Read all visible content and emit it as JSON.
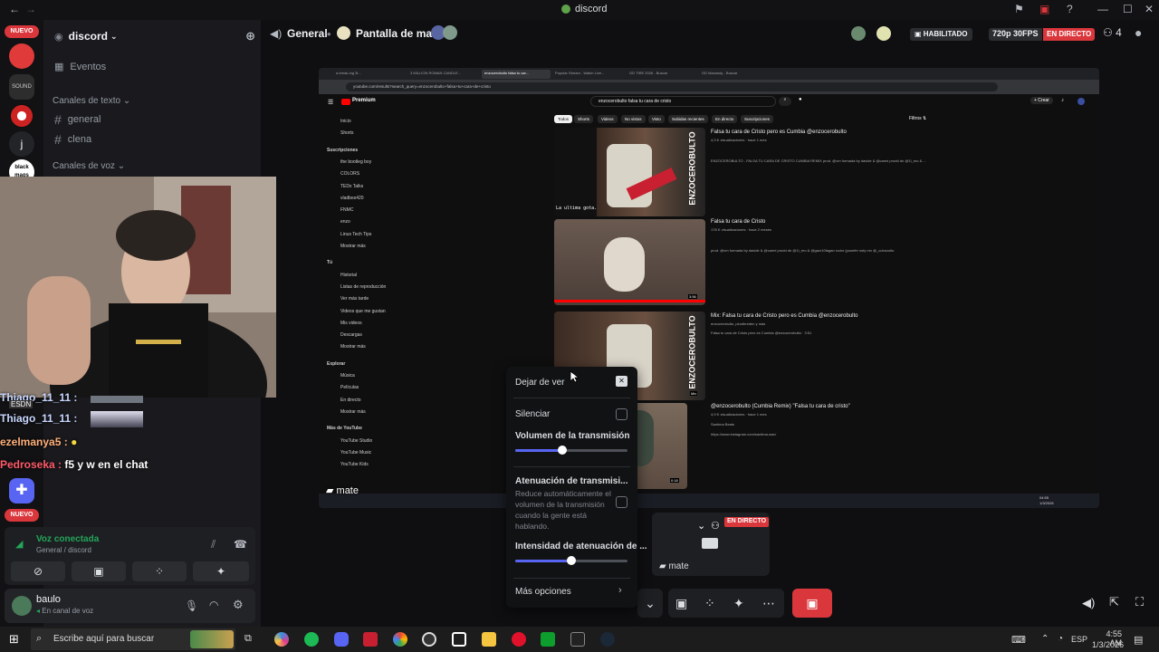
{
  "window": {
    "title": "discord"
  },
  "server_rail": {
    "nuevo_label": "NUEVO",
    "server_letter": "j",
    "server_text_a": "SOUND",
    "server_text_b": "black mags"
  },
  "channels": {
    "server_name": "discord",
    "events": "Eventos",
    "text_category": "Canales de texto",
    "text_channels": [
      "general",
      "clena"
    ],
    "voice_category": "Canales de voz"
  },
  "chat_overlay": {
    "lines": [
      {
        "user": "Thiago_11_11 :",
        "text": ""
      },
      {
        "user": "Thiago_11_11 :",
        "text": ""
      },
      {
        "user": "ezelmanya5 :",
        "text": ""
      },
      {
        "user": "Pedroseka :",
        "text": "f5 y w en el chat"
      }
    ],
    "small_tag": "ESDN"
  },
  "voice": {
    "status": "Voz conectada",
    "location": "General / discord"
  },
  "user": {
    "name": "baulo",
    "status": "En canal de voz"
  },
  "header": {
    "channel": "General",
    "stream_name": "Pantalla de mate",
    "enabled_badge": "HABILITADO",
    "quality": "720p 30FPS",
    "live_badge": "EN DIRECTO",
    "viewers": "4"
  },
  "stream": {
    "streamer_label": "mate",
    "browser": {
      "address": "youtube.com/results?search_query=enzocerobulto+falsa+tu+cara+de+cristo",
      "tabs": [
        "a break-ing 3t...",
        "3 MILLION ROMAN CANDLE...",
        "enzocerobulto falsa tu car...",
        "Popular Stream - Watch Live...",
        "GD TIRE 2026 - Buscar",
        "GD Maxandy - Buscar"
      ]
    },
    "youtube": {
      "logo": "Premium",
      "search": "enzocerobulto falsa tu cara de cristo",
      "create": "+ Crear",
      "filters": "Filtros",
      "chips": [
        "Todos",
        "Shorts",
        "Videos",
        "No vistos",
        "Visto",
        "Subidas recientes",
        "En directo",
        "Suscripciones"
      ],
      "sidebar": [
        "Inicio",
        "Shorts",
        "Suscripciones",
        "the bootleg boy",
        "COLORS",
        "TEDx Talks",
        "vladbes420",
        "FNMC",
        "enzo",
        "Linus Tech Tips",
        "Mostrar más",
        "Tú",
        "Historial",
        "Listas de reproducción",
        "Ver más tarde",
        "Videos que me gustan",
        "Mis videos",
        "Descargas",
        "Mostrar más",
        "Explorar",
        "Música",
        "Películas",
        "En directo",
        "Mostrar más",
        "Más de YouTube",
        "YouTube Studio",
        "YouTube Music",
        "YouTube Kids"
      ],
      "thumb_text": "ENZOCEROBULTO",
      "thumb_caption": "La ultima gota.",
      "thumb2_duration": "3:56",
      "thumb4_duration": "0:18",
      "videos": [
        {
          "title": "Falsa tu cara de Cristo pero es Cumbia @enzocerobulto",
          "meta": "4,3 K visualizaciones · hace 1 mes",
          "desc": "ENZOCEROBULTO - FALSA TU CARA DE CRISTO CUMBIA REMIX prod. @vm formada by davide & @carmi prodd dn @1l_ero & ..."
        },
        {
          "title": "Falsa tu cara de Cristo",
          "meta": "178 K visualizaciones · hace 2 meses",
          "desc": "prod. @vm formada by davide & @carmi prodd dn @1l_ero & @gacr10fagan rudor (pusefer ssfy mn @_cuboculto"
        },
        {
          "title": "Mix: Falsa tu cara de Cristo pero es Cumbia @enzocerobulto",
          "meta": "enzocerobulto, pinothreden y más",
          "desc": "Falsa tu cara de Cristo pero es Cumbia @enzocerobulto · 3:51"
        },
        {
          "title": "@enzocerobulto (Cumbia Remix) \"Falsa tu cara de cristo\"",
          "meta": "4,9 K visualizaciones · hace 1 mes",
          "desc": "https://www.instagram.com/santima.wav/"
        }
      ],
      "mix_badge": "Mix",
      "channel_4": "Santima Beats",
      "taskbar_time": "04:55",
      "taskbar_date": "1/3/2026"
    }
  },
  "popup": {
    "stop_watching": "Dejar de ver",
    "mute": "Silenciar",
    "volume_label": "Volumen de la transmisión",
    "volume": 0.42,
    "attenuation_label": "Atenuación de transmisi...",
    "attenuation_desc": "Reduce automáticamente el volumen de la transmisión cuando la gente está hablando.",
    "intensity_label": "Intensidad de atenuación de ...",
    "intensity": 0.5,
    "more_options": "Más opciones"
  },
  "mini_tile": {
    "live": "EN DIRECTO",
    "label": "mate"
  },
  "taskbar": {
    "search": "Escribe aquí para buscar",
    "lang": "ESP",
    "time": "4:55 AM",
    "date": "1/3/2026"
  },
  "colors": {
    "accent": "#5865f2",
    "red": "#da373c",
    "green": "#23a55a",
    "bg": "#0f0f12"
  }
}
